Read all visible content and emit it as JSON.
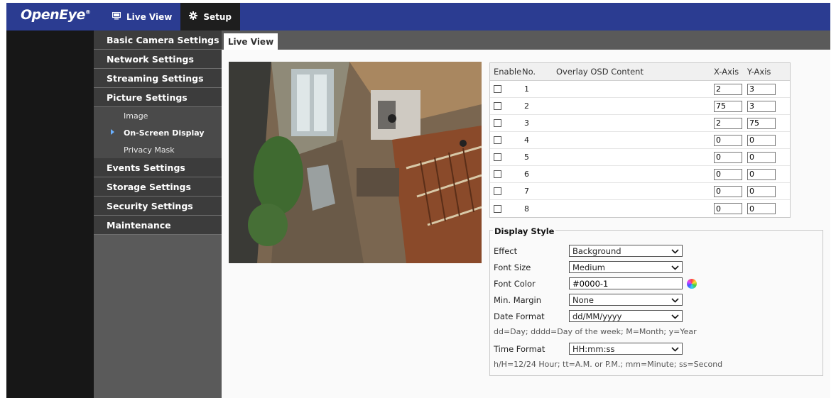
{
  "header": {
    "logo": "OpenEye",
    "logo_mark": "®",
    "nav": [
      {
        "label": "Live View",
        "icon": "monitor-icon"
      },
      {
        "label": "Setup",
        "icon": "gear-icon"
      }
    ]
  },
  "sidebar": {
    "items": [
      {
        "label": "Basic Camera Settings"
      },
      {
        "label": "Network Settings"
      },
      {
        "label": "Streaming Settings"
      },
      {
        "label": "Picture Settings"
      },
      {
        "label": "Events Settings"
      },
      {
        "label": "Storage Settings"
      },
      {
        "label": "Security Settings"
      },
      {
        "label": "Maintenance"
      }
    ],
    "subitems": [
      {
        "label": "Image"
      },
      {
        "label": "On-Screen Display"
      },
      {
        "label": "Privacy Mask"
      }
    ]
  },
  "tab": {
    "label": "Live View"
  },
  "osd": {
    "headers": {
      "enable": "Enable",
      "no": "No.",
      "content": "Overlay OSD Content",
      "x": "X-Axis",
      "y": "Y-Axis"
    },
    "rows": [
      {
        "no": "1",
        "x": "2",
        "y": "3"
      },
      {
        "no": "2",
        "x": "75",
        "y": "3"
      },
      {
        "no": "3",
        "x": "2",
        "y": "75"
      },
      {
        "no": "4",
        "x": "0",
        "y": "0"
      },
      {
        "no": "5",
        "x": "0",
        "y": "0"
      },
      {
        "no": "6",
        "x": "0",
        "y": "0"
      },
      {
        "no": "7",
        "x": "0",
        "y": "0"
      },
      {
        "no": "8",
        "x": "0",
        "y": "0"
      }
    ]
  },
  "display_style": {
    "legend": "Display Style",
    "effect": {
      "label": "Effect",
      "value": "Background"
    },
    "font_size": {
      "label": "Font Size",
      "value": "Medium"
    },
    "font_color": {
      "label": "Font Color",
      "value": "#0000-1"
    },
    "min_margin": {
      "label": "Min. Margin",
      "value": "None"
    },
    "date_format": {
      "label": "Date Format",
      "value": "dd/MM/yyyy"
    },
    "date_hint": "dd=Day; dddd=Day of the week; M=Month; y=Year",
    "time_format": {
      "label": "Time Format",
      "value": "HH:mm:ss"
    },
    "time_hint": "h/H=12/24 Hour; tt=A.M. or P.M.; mm=Minute; ss=Second"
  },
  "colors": {
    "topbar": "#2b3c91",
    "sidebar_item": "#3c3c3c",
    "sidebar_bg": "#5a5a5a",
    "accent_arrow": "#6ab0ff"
  }
}
